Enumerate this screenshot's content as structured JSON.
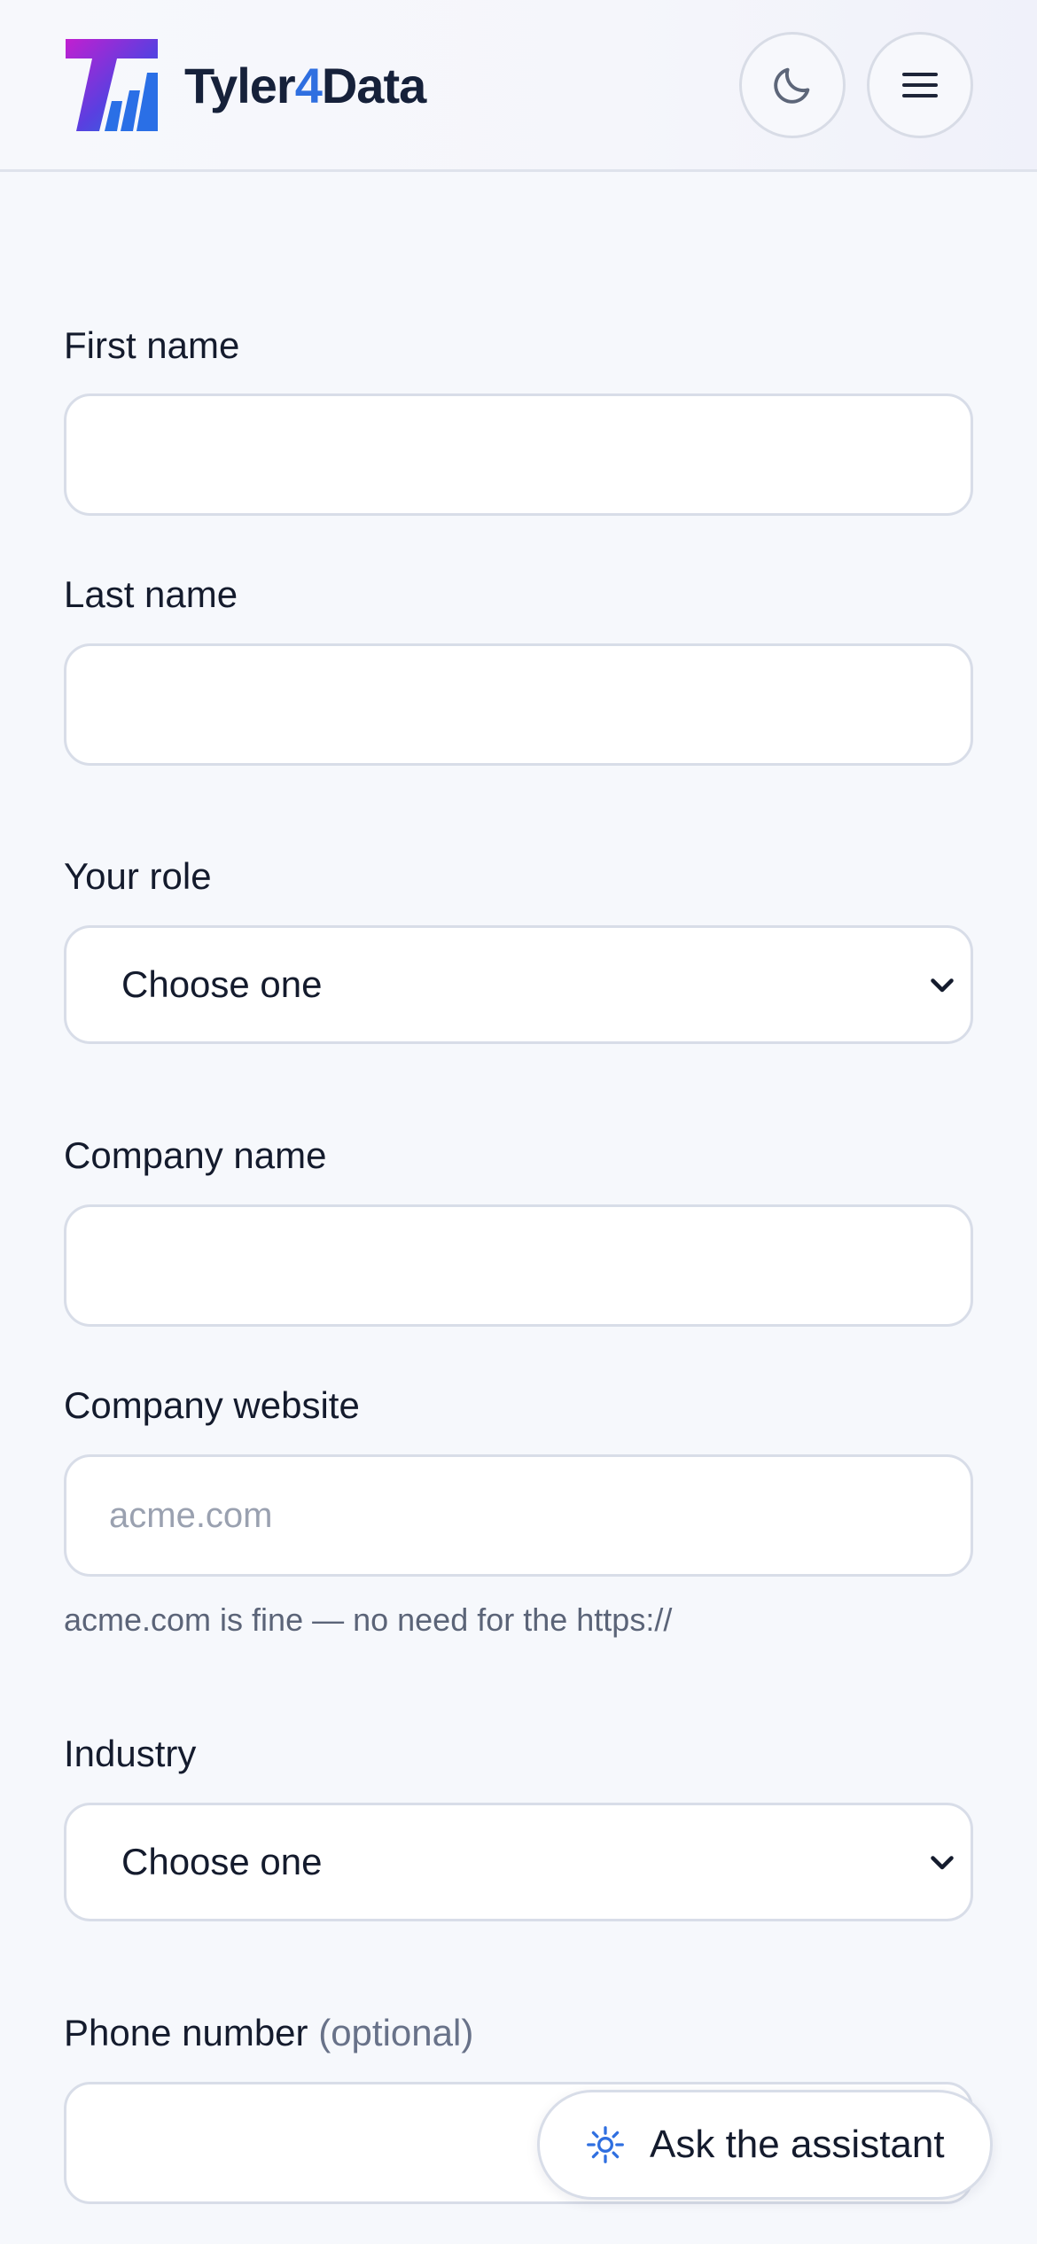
{
  "header": {
    "brand_prefix": "Tyler",
    "brand_accent": "4",
    "brand_suffix": "Data",
    "theme_toggle_icon": "moon-icon",
    "menu_icon": "hamburger-menu-icon"
  },
  "form": {
    "first_name": {
      "label": "First name",
      "value": "",
      "placeholder": ""
    },
    "last_name": {
      "label": "Last name",
      "value": "",
      "placeholder": ""
    },
    "role": {
      "label": "Your role",
      "selected": "Choose one"
    },
    "company_name": {
      "label": "Company name",
      "value": "",
      "placeholder": ""
    },
    "company_website": {
      "label": "Company website",
      "value": "",
      "placeholder": "acme.com",
      "hint": "acme.com is fine — no need for the https://"
    },
    "industry": {
      "label": "Industry",
      "selected": "Choose one"
    },
    "phone": {
      "label": "Phone number",
      "optional_note": "(optional)",
      "value": ""
    }
  },
  "assistant": {
    "label": "Ask the assistant",
    "icon": "sparkle-icon"
  },
  "colors": {
    "brand_accent": "#2f6fe0",
    "logo_gradient_start": "#c21fd0",
    "logo_gradient_end": "#1b77e0",
    "background": "#f6f8fc"
  }
}
